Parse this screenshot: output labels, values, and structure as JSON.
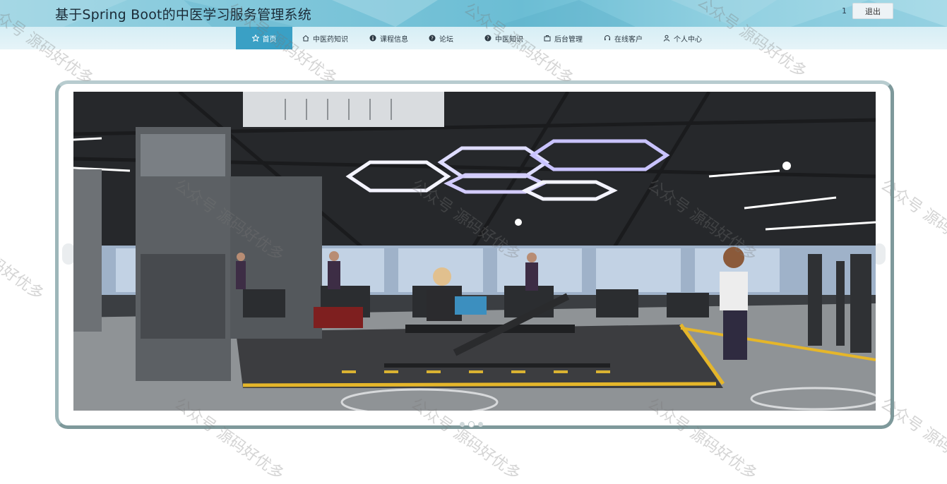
{
  "header": {
    "title": "基于Spring Boot的中医学习服务管理系统",
    "user": "1",
    "logout_label": "退出"
  },
  "nav": {
    "items": [
      {
        "label": "首页",
        "icon": "star-icon"
      },
      {
        "label": "中医药知识",
        "icon": "home-icon"
      },
      {
        "label": "课程信息",
        "icon": "info-icon"
      },
      {
        "label": "论坛",
        "icon": "question-icon"
      },
      {
        "label": "中医知识",
        "icon": "question-icon"
      },
      {
        "label": "后台管理",
        "icon": "briefcase-icon"
      },
      {
        "label": "在线客户",
        "icon": "headset-icon"
      },
      {
        "label": "个人中心",
        "icon": "user-icon"
      }
    ]
  },
  "carousel": {
    "slide_subject": "gym-interior-photo",
    "slide_count": 3,
    "active_index": 1
  },
  "watermark": {
    "text": "公众号 源码好优多"
  },
  "colors": {
    "nav_active": "#3aa0c5",
    "header_accent": "#7fc6da",
    "frame_border": "#7e999b"
  }
}
